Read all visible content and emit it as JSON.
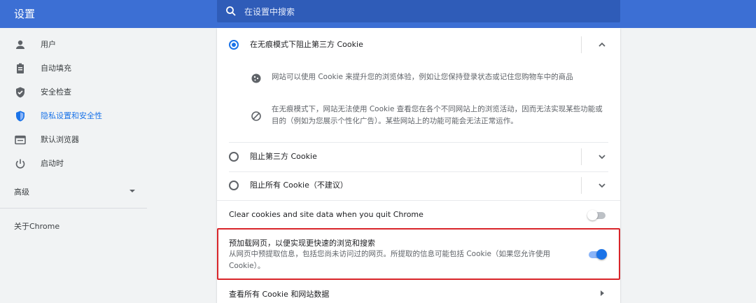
{
  "app": {
    "title": "设置"
  },
  "search": {
    "placeholder": "在设置中搜索"
  },
  "sidebar": {
    "items": [
      {
        "label": "用户",
        "icon": "person-icon"
      },
      {
        "label": "自动填充",
        "icon": "clipboard-icon"
      },
      {
        "label": "安全检查",
        "icon": "shield-check-icon"
      },
      {
        "label": "隐私设置和安全性",
        "icon": "shield-icon",
        "active": true
      },
      {
        "label": "默认浏览器",
        "icon": "browser-icon"
      },
      {
        "label": "启动时",
        "icon": "power-icon"
      }
    ],
    "advanced": "高级",
    "about": "关于Chrome"
  },
  "cookies": {
    "option_incognito": "在无痕模式下阻止第三方 Cookie",
    "detail_1": "网站可以使用 Cookie 来提升您的浏览体验，例如让您保持登录状态或记住您购物车中的商品",
    "detail_2": "在无痕模式下，网站无法使用 Cookie 查看您在各个不同网站上的浏览活动，因而无法实现某些功能或目的（例如为您展示个性化广告）。某些网站上的功能可能会无法正常运作。",
    "option_block_third": "阻止第三方 Cookie",
    "option_block_all": "阻止所有 Cookie（不建议）",
    "clear_on_quit": "Clear cookies and site data when you quit Chrome",
    "preload_title": "预加载网页，以便实现更快速的浏览和搜索",
    "preload_desc": "从网页中预提取信息，包括您尚未访问过的网页。所提取的信息可能包括 Cookie（如果您允许使用 Cookie）。",
    "see_all": "查看所有 Cookie 和网站数据"
  },
  "colors": {
    "accent": "#1a73e8",
    "topbar": "#3c6fd4",
    "highlight": "#d9252a"
  }
}
